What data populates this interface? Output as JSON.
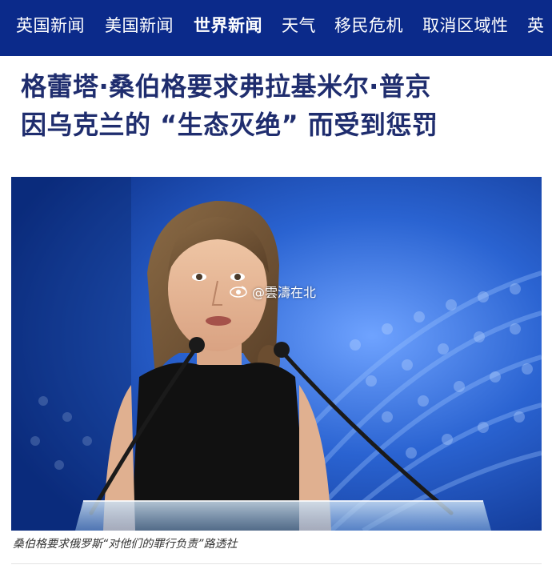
{
  "nav": {
    "items": [
      {
        "label": "英国新闻",
        "active": false
      },
      {
        "label": "美国新闻",
        "active": false
      },
      {
        "label": "世界新闻",
        "active": true
      },
      {
        "label": "天气",
        "active": false
      },
      {
        "label": "移民危机",
        "active": false
      },
      {
        "label": "取消区域性",
        "active": false
      },
      {
        "label": "英",
        "active": false
      }
    ]
  },
  "article": {
    "headline_line1": "格蕾塔·桑伯格要求弗拉基米尔·普京",
    "headline_line2": "因乌克兰的 “生态灭绝” 而受到惩罚",
    "watermark": "@雲濤在北",
    "caption": "桑伯格要求俄罗斯“对他们的罪行负责”路透社"
  },
  "colors": {
    "nav_background": "#0b2a8a",
    "headline": "#1f2d6e",
    "photo_background": "#1b4fb8"
  },
  "icons": {
    "watermark_icon": "weibo-eye-icon"
  }
}
